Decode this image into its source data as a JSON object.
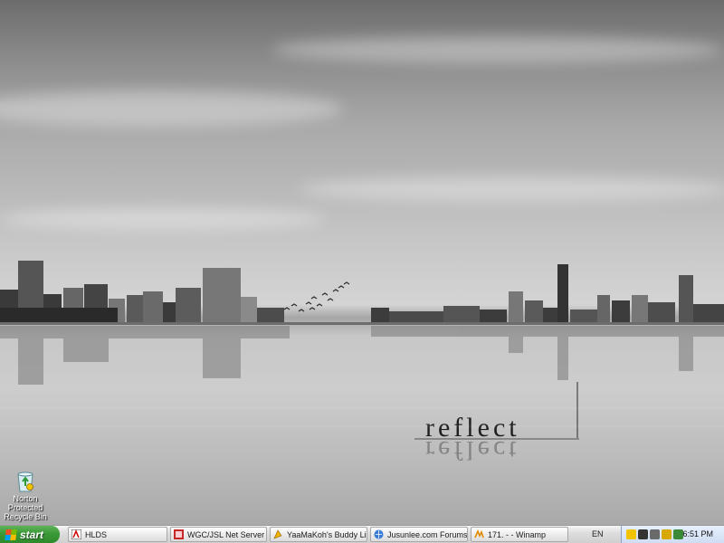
{
  "wallpaper": {
    "title": "reflect"
  },
  "desktop_icon": {
    "label": "Norton Protected Recycle Bin"
  },
  "taskbar": {
    "start_label": "start",
    "buttons": [
      {
        "label": "HLDS",
        "icon": "hlds-icon"
      },
      {
        "label": "WGC/JSL Net Server ...",
        "icon": "server-icon"
      },
      {
        "label": "YaaMaKoh's Buddy Li...",
        "icon": "buddy-list-icon"
      },
      {
        "label": "Jusunlee.com Forums...",
        "icon": "browser-icon"
      },
      {
        "label": "171.  -  - Winamp",
        "icon": "winamp-icon"
      }
    ],
    "language": "EN",
    "clock": "6:51 PM"
  }
}
